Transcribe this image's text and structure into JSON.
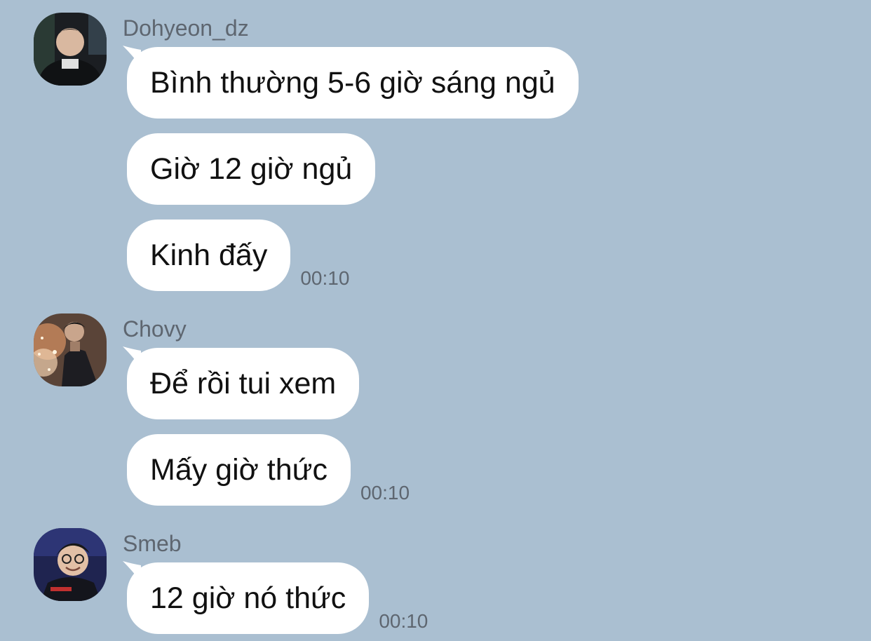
{
  "conversation": [
    {
      "sender": "Dohyeon_dz",
      "avatar": "dohyeon-avatar",
      "messages": [
        "Bình thường 5-6 giờ sáng ngủ",
        "Giờ 12 giờ ngủ",
        "Kinh đấy"
      ],
      "time": "00:10"
    },
    {
      "sender": "Chovy",
      "avatar": "chovy-avatar",
      "messages": [
        "Để rồi tui xem",
        "Mấy giờ thức"
      ],
      "time": "00:10"
    },
    {
      "sender": "Smeb",
      "avatar": "smeb-avatar",
      "messages": [
        "12 giờ nó thức"
      ],
      "time": "00:10"
    }
  ],
  "colors": {
    "background": "#aabfd1",
    "bubble": "#ffffff",
    "sender_text": "#5e6670",
    "message_text": "#111111"
  }
}
